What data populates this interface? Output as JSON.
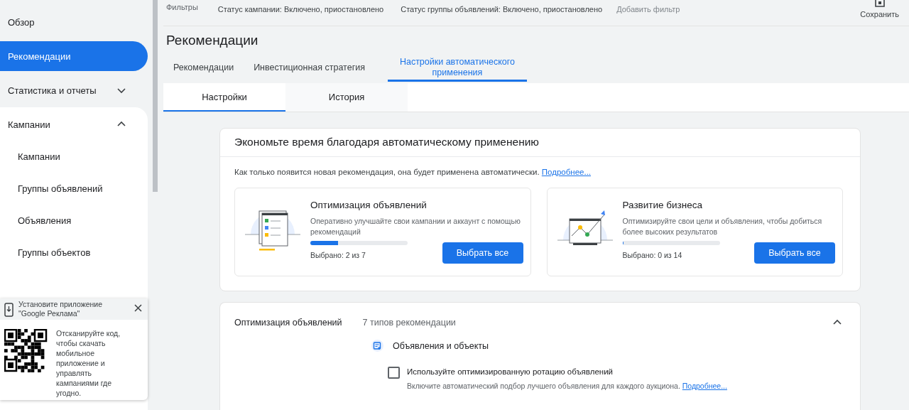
{
  "sidebar": {
    "items": [
      {
        "label": "Обзор",
        "selected": false
      },
      {
        "label": "Рекомендации",
        "selected": true
      },
      {
        "label": "Статистика и отчеты",
        "selected": false,
        "expanded": false
      },
      {
        "label": "Кампании",
        "selected": false,
        "expanded": true,
        "children": [
          {
            "label": "Кампании",
            "selected": false
          },
          {
            "label": "Группы объявлений",
            "selected": false
          },
          {
            "label": "Объявления",
            "selected": false
          },
          {
            "label": "Группы объектов",
            "selected": false
          }
        ]
      }
    ]
  },
  "install_popup": {
    "title": "Установите приложение \"Google Реклама\"",
    "text": "Отсканируйте код, чтобы скачать мобильное приложение и управлять кампаниями где угодно."
  },
  "filters": {
    "label": "Фильтры",
    "chips": [
      "Статус кампании: Включено, приостановлено",
      "Статус группы объявлений: Включено, приостановлено"
    ],
    "add": "Добавить фильтр"
  },
  "save_button": "Сохранить",
  "page_title": "Рекомендации",
  "tabs": [
    {
      "label": "Рекомендации",
      "selected": false
    },
    {
      "label": "Инвестиционная стратегия",
      "selected": false
    },
    {
      "label": "Настройки автоматического применения",
      "selected": true
    }
  ],
  "subtabs": [
    {
      "label": "Настройки",
      "selected": true
    },
    {
      "label": "История",
      "selected": false
    }
  ],
  "auto_apply": {
    "title": "Экономьте время благодаря автоматическому применению",
    "description": "Как только появится новая рекомендация, она будет применена автоматически.",
    "link": "Подробнее...",
    "cards": [
      {
        "kind": "checklist",
        "title": "Оптимизация объявлений",
        "text": "Оперативно улучшайте свои кампании и аккаунт с помощью рекомендаций",
        "level": 0.2857,
        "reading": "Выбрано: 2 из 7",
        "button": "Выбрать все"
      },
      {
        "kind": "growth",
        "title": "Развитие бизнеса",
        "text": "Оптимизируйте свои цели и объявления, чтобы добиться более высоких результатов",
        "level": 0,
        "reading": "Выбрано: 0 из 14",
        "button": "Выбрать все"
      }
    ]
  },
  "section": {
    "title": "Оптимизация объявлений",
    "count": "7 типов рекомендации",
    "expanded": true,
    "group": {
      "title": "Объявления и объекты",
      "items": [
        {
          "label": "Используйте оптимизированную ротацию объявлений",
          "checked": false,
          "description": "Включите автоматический подбор лучшего объявления для каждого аукциона.",
          "link": "Подробнее..."
        }
      ]
    }
  }
}
